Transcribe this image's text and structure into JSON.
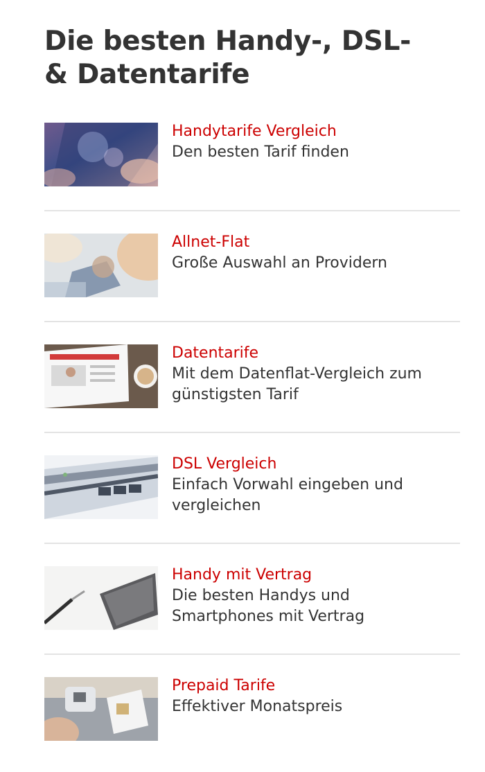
{
  "section": {
    "title": "Die besten Handy-, DSL- & Datentarife"
  },
  "items": [
    {
      "title": "Handytarife Vergleich",
      "description": "Den besten Tarif finden",
      "image": "smartphone-photo"
    },
    {
      "title": "Allnet-Flat",
      "description": "Große Auswahl an Providern",
      "image": "hand-touch-photo"
    },
    {
      "title": "Datentarife",
      "description": "Mit dem Datenflat-Vergleich zum günstigsten Tarif",
      "image": "tablet-coffee-photo"
    },
    {
      "title": "DSL Vergleich",
      "description": "Einfach Vorwahl eingeben und vergleichen",
      "image": "router-cable-photo"
    },
    {
      "title": "Handy mit Vertrag",
      "description": "Die besten Handys und Smartphones mit Vertrag",
      "image": "phone-pen-photo"
    },
    {
      "title": "Prepaid Tarife",
      "description": "Effektiver Monatspreis",
      "image": "sim-card-photo"
    }
  ],
  "colors": {
    "link": "#cc0000",
    "text": "#333333",
    "divider": "#e3e3e3"
  }
}
